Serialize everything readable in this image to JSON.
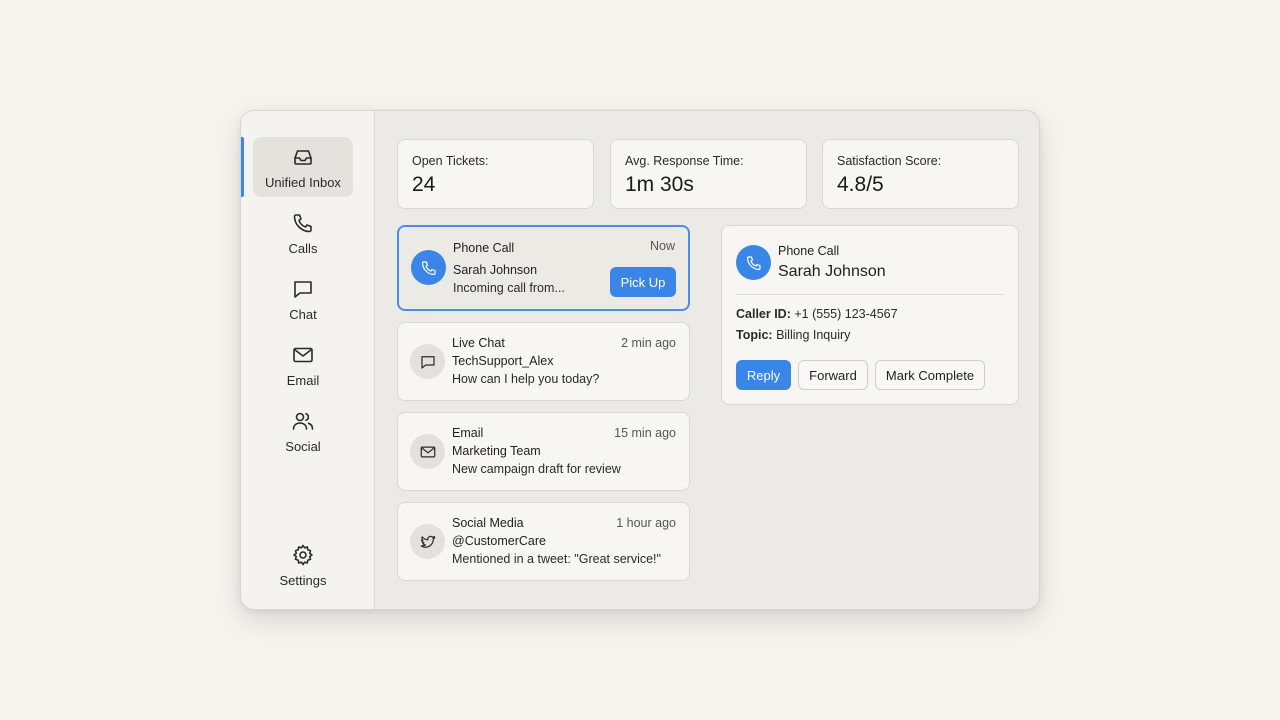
{
  "sidebar": {
    "items": [
      {
        "label": "Unified Inbox",
        "icon": "inbox-icon",
        "active": true
      },
      {
        "label": "Calls",
        "icon": "phone-icon"
      },
      {
        "label": "Chat",
        "icon": "chat-icon"
      },
      {
        "label": "Email",
        "icon": "mail-icon"
      },
      {
        "label": "Social",
        "icon": "users-icon"
      }
    ],
    "settings": {
      "label": "Settings",
      "icon": "gear-icon"
    }
  },
  "stats": [
    {
      "label": "Open Tickets:",
      "value": "24"
    },
    {
      "label": "Avg. Response Time:",
      "value": "1m 30s"
    },
    {
      "label": "Satisfaction Score:",
      "value": "4.8/5"
    }
  ],
  "messages": [
    {
      "type": "Phone Call",
      "time": "Now",
      "name": "Sarah Johnson",
      "preview": "Incoming call from...",
      "icon": "phone-icon",
      "action": "Pick Up"
    },
    {
      "type": "Live Chat",
      "time": "2 min ago",
      "name": "TechSupport_Alex",
      "preview": "How can I help you today?",
      "icon": "chat-icon"
    },
    {
      "type": "Email",
      "time": "15 min ago",
      "name": "Marketing Team",
      "preview": "New campaign draft for review",
      "icon": "mail-icon"
    },
    {
      "type": "Social Media",
      "time": "1 hour ago",
      "name": "@CustomerCare",
      "preview": "Mentioned in a tweet: \"Great service!\"",
      "icon": "twitter-icon"
    }
  ],
  "detail": {
    "type": "Phone Call",
    "name": "Sarah Johnson",
    "caller_id_label": "Caller ID:",
    "caller_id": "+1 (555) 123-4567",
    "topic_label": "Topic:",
    "topic": "Billing Inquiry",
    "buttons": {
      "reply": "Reply",
      "forward": "Forward",
      "complete": "Mark Complete"
    }
  },
  "colors": {
    "accent": "#3a86e8",
    "background": "#f6f4ef",
    "panel": "#ebeae6"
  }
}
